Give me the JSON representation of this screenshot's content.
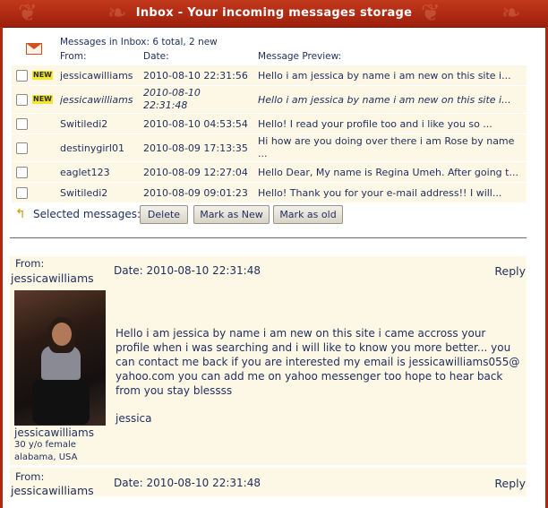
{
  "window": {
    "title": "Inbox - Your incoming messages storage"
  },
  "summary": "Messages in Inbox: 6 total, 2 new",
  "columns": {
    "from": "From:",
    "date": "Date:",
    "preview": "Message Preview:"
  },
  "new_badge": "NEW",
  "messages": [
    {
      "from": "jessicawilliams",
      "date": "2010-08-10 22:31:56",
      "preview": "Hello i am jessica by name i am new on this site i...",
      "is_new": true
    },
    {
      "from": "jessicawilliams",
      "date": "2010-08-10 22:31:48",
      "preview": "Hello i am jessica by name i am new on this site i...",
      "is_new": true
    },
    {
      "from": "Switiledi2",
      "date": "2010-08-10 04:53:54",
      "preview": "Hello! I read your profile too and i like you so ...",
      "is_new": false
    },
    {
      "from": "destinygirl01",
      "date": "2010-08-09 17:13:35",
      "preview": "Hi how are you doing over there i am Rose by name ...",
      "is_new": false
    },
    {
      "from": "eaglet123",
      "date": "2010-08-09 12:27:04",
      "preview": "Hello Dear, My name is Regina Umeh. After going t...",
      "is_new": false
    },
    {
      "from": "Switiledi2",
      "date": "2010-08-09 09:01:23",
      "preview": "Hello! Thank you for your e-mail address!! I will...",
      "is_new": false
    }
  ],
  "actions": {
    "label": "Selected messages:",
    "delete": "Delete",
    "mark_new": "Mark as New",
    "mark_old": "Mark as old"
  },
  "open_message": {
    "from_label": "From:",
    "from": "jessicawilliams",
    "date": "Date: 2010-08-10 22:31:48",
    "reply": "Reply",
    "sender": {
      "name": "jessicawilliams",
      "age_gender": "30 y/o female",
      "location": "alabama, USA"
    },
    "body": "Hello i am jessica by name i am new on this site i came accross your profile when i was searching and i will like to know you more better... you can contact me back if you are interested my email is jessicawilliams055@ yahoo.com you can add me on yahoo messenger too hope to hear back from you stay blessss",
    "signature": "jessica"
  },
  "colors": {
    "title_bar": "#b0290f",
    "row_bg": "#fdf8e5",
    "text": "#1f2d5c",
    "new_badge": "#f5e62e"
  }
}
